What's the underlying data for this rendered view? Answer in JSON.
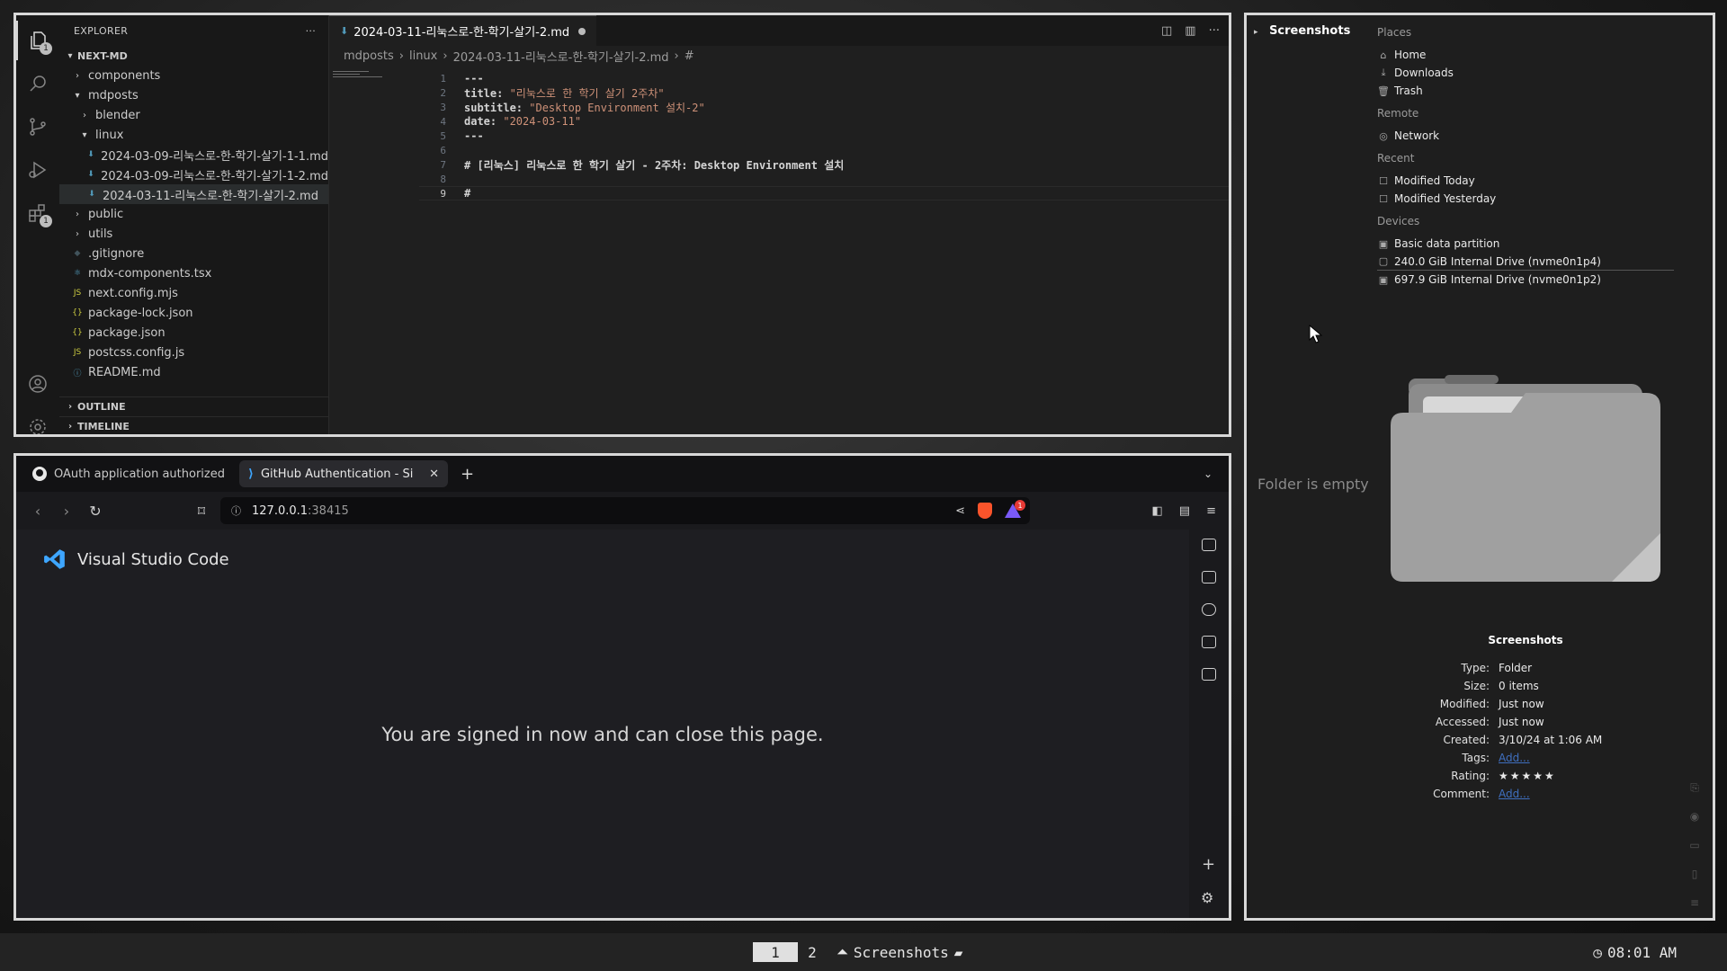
{
  "vscode": {
    "explorer_title": "EXPLORER",
    "explorer_menu": "···",
    "project": "NEXT-MD",
    "tree": [
      {
        "label": "components",
        "type": "folder",
        "open": false,
        "depth": 1
      },
      {
        "label": "mdposts",
        "type": "folder",
        "open": true,
        "depth": 1
      },
      {
        "label": "blender",
        "type": "folder",
        "open": false,
        "depth": 2
      },
      {
        "label": "linux",
        "type": "folder",
        "open": true,
        "depth": 2
      },
      {
        "label": "2024-03-09-리눅스로-한-학기-살기-1-1.md",
        "type": "md",
        "depth": 3
      },
      {
        "label": "2024-03-09-리눅스로-한-학기-살기-1-2.md",
        "type": "md",
        "depth": 3
      },
      {
        "label": "2024-03-11-리눅스로-한-학기-살기-2.md",
        "type": "md",
        "depth": 3,
        "selected": true
      },
      {
        "label": "public",
        "type": "folder",
        "open": false,
        "depth": 1
      },
      {
        "label": "utils",
        "type": "folder",
        "open": false,
        "depth": 1
      },
      {
        "label": ".gitignore",
        "type": "git",
        "depth": 1
      },
      {
        "label": "mdx-components.tsx",
        "type": "tsx",
        "depth": 1
      },
      {
        "label": "next.config.mjs",
        "type": "js",
        "depth": 1
      },
      {
        "label": "package-lock.json",
        "type": "json",
        "depth": 1
      },
      {
        "label": "package.json",
        "type": "json",
        "depth": 1
      },
      {
        "label": "postcss.config.js",
        "type": "js",
        "depth": 1
      },
      {
        "label": "README.md",
        "type": "info",
        "depth": 1
      }
    ],
    "outline": "OUTLINE",
    "timeline": "TIMELINE",
    "tab": "2024-03-11-리눅스로-한-학기-살기-2.md",
    "crumbs": [
      "mdposts",
      "linux",
      "2024-03-11-리눅스로-한-학기-살기-2.md",
      "#"
    ],
    "activity_badges": {
      "explorer": "1",
      "extensions": "1"
    },
    "lines": [
      {
        "n": "1",
        "k": "---",
        "s": ""
      },
      {
        "n": "2",
        "k": "title: ",
        "s": "\"리눅스로 한 학기 살기 2주차\""
      },
      {
        "n": "3",
        "k": "subtitle: ",
        "s": "\"Desktop Environment 설치-2\""
      },
      {
        "n": "4",
        "k": "date: ",
        "s": "\"2024-03-11\""
      },
      {
        "n": "5",
        "k": "---",
        "s": ""
      },
      {
        "n": "6",
        "k": "",
        "s": ""
      },
      {
        "n": "7",
        "k": "# [리눅스] 리눅스로 한 학기 살기 - 2주차: Desktop Environment 설치",
        "s": ""
      },
      {
        "n": "8",
        "k": "",
        "s": ""
      },
      {
        "n": "9",
        "k": "#",
        "s": ""
      }
    ]
  },
  "browser": {
    "tabs": [
      {
        "label": "OAuth application authorized",
        "icon": "github-icon"
      },
      {
        "label": "GitHub Authentication - Si",
        "icon": "vscode-icon",
        "active": true
      }
    ],
    "url_host": "127.0.0.1",
    "url_port": ":38415",
    "shields_badge": "1",
    "page_brand": "Visual Studio Code",
    "page_message": "You are signed in now and can close this page."
  },
  "files": {
    "header": "Screenshots",
    "sections": [
      {
        "title": "Places",
        "items": [
          {
            "label": "Home",
            "icon": "⌂"
          },
          {
            "label": "Downloads",
            "icon": "⤓"
          },
          {
            "label": "Trash",
            "icon": "🗑"
          }
        ]
      },
      {
        "title": "Remote",
        "items": [
          {
            "label": "Network",
            "icon": "◎"
          }
        ]
      },
      {
        "title": "Recent",
        "items": [
          {
            "label": "Modified Today",
            "icon": "☐"
          },
          {
            "label": "Modified Yesterday",
            "icon": "☐"
          }
        ]
      },
      {
        "title": "Devices",
        "items": [
          {
            "label": "Basic data partition",
            "icon": "▣"
          },
          {
            "label": "240.0 GiB Internal Drive (nvme0n1p4)",
            "icon": "▢",
            "underline": true
          },
          {
            "label": "697.9 GiB Internal Drive (nvme0n1p2)",
            "icon": "▣"
          }
        ]
      }
    ],
    "empty_message": "Folder is empty",
    "folder_name": "Screenshots",
    "properties": [
      {
        "key": "Type:",
        "value": "Folder"
      },
      {
        "key": "Size:",
        "value": "0 items"
      },
      {
        "key": "Modified:",
        "value": "Just now"
      },
      {
        "key": "Accessed:",
        "value": "Just now"
      },
      {
        "key": "Created:",
        "value": "3/10/24 at 1:06 AM"
      },
      {
        "key": "Tags:",
        "value": "Add...",
        "link": true
      },
      {
        "key": "Rating:",
        "value": "★★★★★",
        "stars": true
      },
      {
        "key": "Comment:",
        "value": "Add...",
        "link": true
      }
    ]
  },
  "taskbar": {
    "workspaces": [
      "1",
      "2"
    ],
    "task": "Screenshots",
    "clock": "08:01 AM"
  }
}
